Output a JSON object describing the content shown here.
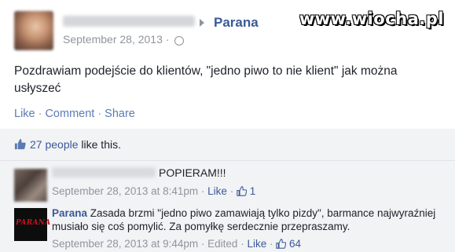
{
  "post": {
    "page_name": "Parana",
    "date": "September 28, 2013 ·",
    "text": "Pozdrawiam podejście do klientów, \"jedno piwo to nie klient\" jak można usłyszeć",
    "actions": [
      "Like",
      "Comment",
      "Share"
    ]
  },
  "watermark": "www.wiocha.pl",
  "likes": {
    "text": "27 people",
    "suffix": " like this."
  },
  "comments": [
    {
      "text": "POPIERAM!!!",
      "date": "September 28, 2013 at 8:41pm",
      "like_label": "Like",
      "likes": "1"
    },
    {
      "author": "Parana",
      "logo_text": "PARANA",
      "text": " Zasada brzmi \"jedno piwo zamawiają tylko pizdy\", barmance najwyraźniej musiało się coś pomylić. Za pomyłkę serdecznie przepraszamy.",
      "date": "September 28, 2013 at 9:44pm",
      "edited_label": "Edited",
      "like_label": "Like",
      "likes": "64"
    }
  ],
  "icons": {
    "thumb": "thumbs-up-icon",
    "globe": "globe-icon",
    "arrow": "arrow-right-icon"
  },
  "colors": {
    "link": "#3b5998",
    "muted": "#90949c",
    "panel": "#f2f3f5"
  }
}
